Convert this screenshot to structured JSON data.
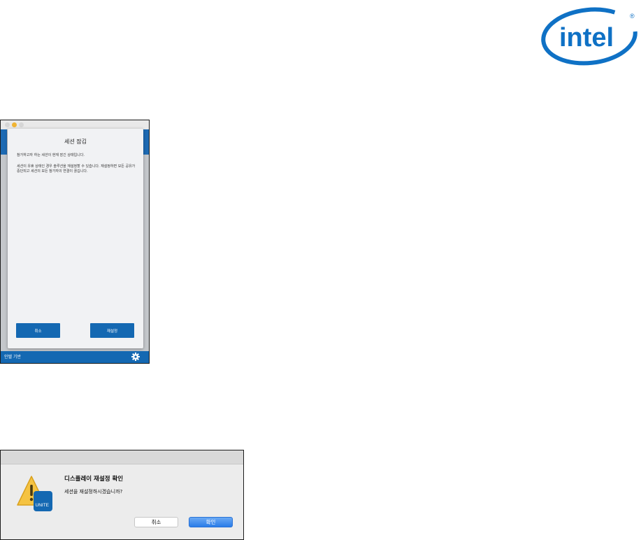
{
  "logo": {
    "text": "intel",
    "color": "#0f71c5"
  },
  "session_window": {
    "title": "세션 잠김",
    "line1": "참가하고자 하는 세션이 현재 잠긴 상태입니다.",
    "body": "세션이 유휴 상태인 경우 솔루션을 재설정할 수 있습니다. 재설정하면 모든 공유가 중단되고 세션의 모든 참가자의 연결이 끊깁니다.",
    "cancel_label": "취소",
    "reset_label": "재설정",
    "footer_label": "인텔 기반",
    "settings_icon": "gear-icon",
    "accent_color": "#1468b2"
  },
  "confirm_dialog": {
    "title": "디스플레이 재설정 확인",
    "message": "세션을 재설정하시겠습니까?",
    "cancel_label": "취소",
    "ok_label": "확인",
    "app_icon_label": "UNITE",
    "icon": "warning-icon"
  }
}
